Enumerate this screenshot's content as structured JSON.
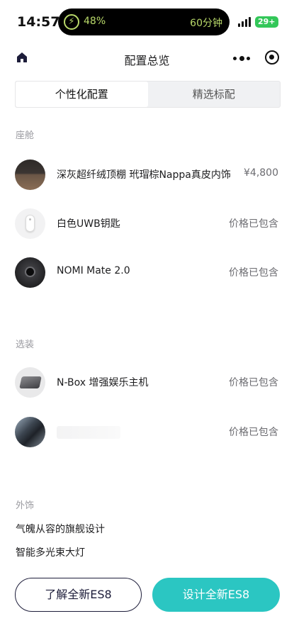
{
  "status_bar": {
    "time": "14:57",
    "battery_percent": "48%",
    "island_right": "60分钟",
    "battery_badge": "29+"
  },
  "nav": {
    "title": "配置总览"
  },
  "tabs": [
    {
      "label": "个性化配置",
      "active": true
    },
    {
      "label": "精选标配",
      "active": false
    }
  ],
  "cabin": {
    "label": "座舱",
    "items": [
      {
        "name": "深灰超纤绒顶棚 玳瑁棕Nappa真皮内饰",
        "price": "¥4,800",
        "thumb_icon": "interior-swatch-icon"
      },
      {
        "name": "白色UWB钥匙",
        "price": "价格已包含",
        "thumb_icon": "uwb-key-icon"
      },
      {
        "name": "NOMI Mate 2.0",
        "price": "价格已包含",
        "thumb_icon": "nomi-mate-icon"
      }
    ]
  },
  "options": {
    "label": "选装",
    "items": [
      {
        "name": "N-Box 增强娱乐主机",
        "price": "价格已包含",
        "thumb_icon": "nbox-console-icon"
      },
      {
        "name": "",
        "price": "价格已包含",
        "thumb_icon": "interior-photo-icon"
      }
    ]
  },
  "exterior": {
    "label": "外饰",
    "items": [
      "气魄从容的旗舰设计",
      "智能多光束大灯"
    ]
  },
  "buttons": {
    "learn": "了解全新ES8",
    "design": "设计全新ES8"
  },
  "colors": {
    "accent": "#2bc6c2",
    "outline": "#1d1d3a",
    "battery_green": "#33c759",
    "island_text": "#b9d96a"
  }
}
